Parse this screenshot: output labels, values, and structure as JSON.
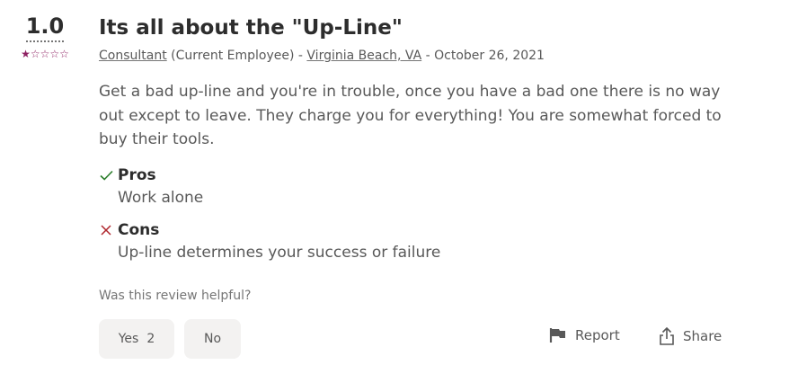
{
  "review": {
    "rating": "1.0",
    "stars_filled": 1,
    "stars_total": 5,
    "title": "Its all about the \"Up-Line\"",
    "job_title": "Consultant",
    "employment_status": "(Current Employee)",
    "sep1": " - ",
    "location": "Virginia Beach, VA",
    "sep2": " - ",
    "date": "October 26, 2021",
    "text": "Get a bad up-line and you're in trouble, once you have a bad one there is no way out except to leave. They charge you for everything! You are somewhat forced to buy their tools.",
    "pros_label": "Pros",
    "pros_text": "Work alone",
    "cons_label": "Cons",
    "cons_text": "Up-line determines your success or failure"
  },
  "helpful": {
    "question": "Was this review helpful?",
    "yes_label": "Yes",
    "yes_count": "2",
    "no_label": "No"
  },
  "actions": {
    "report_label": "Report",
    "share_label": "Share"
  },
  "colors": {
    "star": "#8f2263",
    "pros_check": "#2b7d2b",
    "cons_x": "#b0282f",
    "button_bg": "#f3f2f1"
  },
  "icons": {
    "pros": "checkmark-icon",
    "cons": "x-icon",
    "report": "flag-icon",
    "share": "share-icon"
  }
}
